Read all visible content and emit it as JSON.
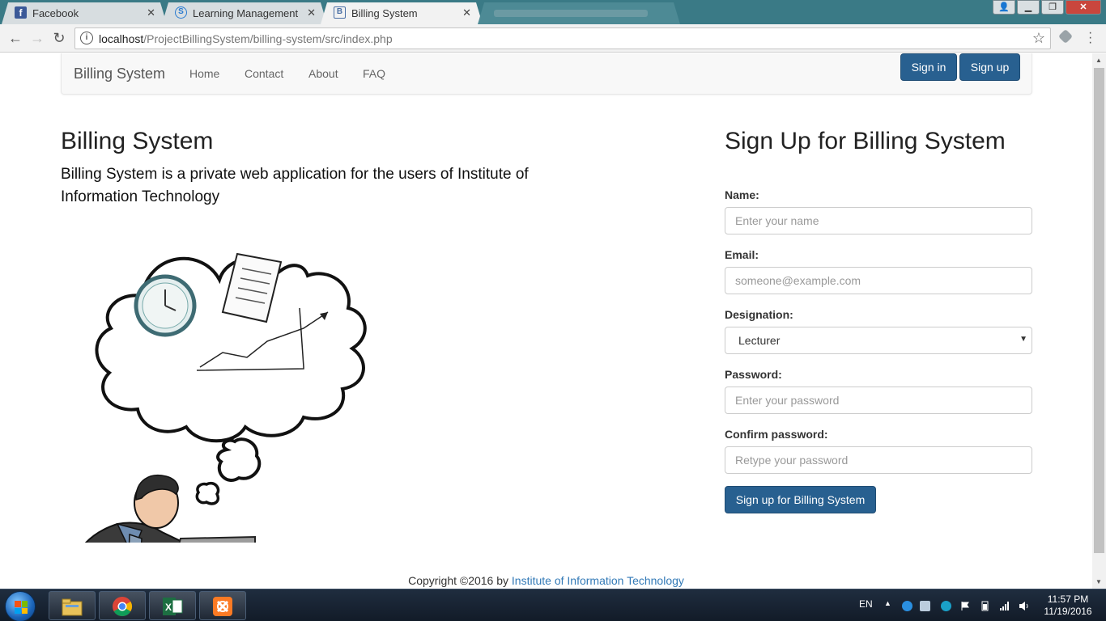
{
  "browser": {
    "tabs": [
      {
        "title": "Facebook",
        "icon": "facebook-icon",
        "active": false
      },
      {
        "title": "Learning Management S",
        "icon": "lms-icon",
        "active": false
      },
      {
        "title": "Billing System",
        "icon": "billing-icon",
        "active": true
      }
    ],
    "url_host": "localhost",
    "url_path": "/ProjectBillingSystem/billing-system/src/index.php"
  },
  "navbar": {
    "brand": "Billing System",
    "links": [
      "Home",
      "Contact",
      "About",
      "FAQ"
    ],
    "signin_label": "Sign in",
    "signup_label": "Sign up"
  },
  "hero": {
    "title": "Billing System",
    "description": "Billing System is a private web application for the users of Institute of Information Technology"
  },
  "signup_form": {
    "title": "Sign Up for Billing System",
    "name_label": "Name:",
    "name_placeholder": "Enter your name",
    "email_label": "Email:",
    "email_placeholder": "someone@example.com",
    "designation_label": "Designation:",
    "designation_value": "Lecturer",
    "password_label": "Password:",
    "password_placeholder": "Enter your password",
    "confirm_label": "Confirm password:",
    "confirm_placeholder": "Retype your password",
    "submit_label": "Sign up for Billing System"
  },
  "footer": {
    "text": "Copyright ©2016 by",
    "link": "Institute of Information Technology"
  },
  "taskbar": {
    "apps": [
      "file-explorer-icon",
      "chrome-icon",
      "excel-icon",
      "xampp-icon"
    ],
    "language": "EN",
    "time": "11:57 PM",
    "date": "11/19/2016"
  },
  "colors": {
    "primary_button": "#286090",
    "link": "#337ab7",
    "tabstrip": "#3a7a86"
  }
}
